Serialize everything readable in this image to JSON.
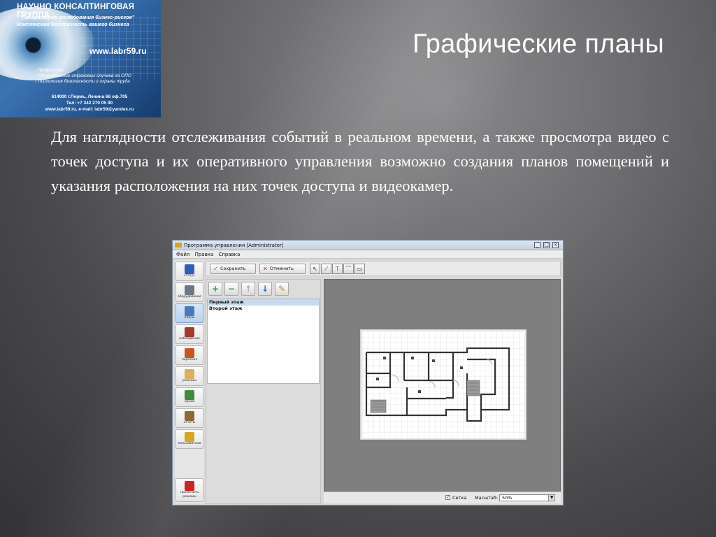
{
  "banner": {
    "title": "НАУЧНО КОНСАЛТИНГОВАЯ ГРУППА",
    "sub1": "\"Лаборатория исследования бизнес-рисков\"",
    "sub2": "Комплексная безопасность вашего бизнеса",
    "url": "www.labr59.ru",
    "bullets": [
      "- Профайлинг",
      "- Расследование страховых случаев на ОПО",
      "- Психология безопасности и охраны труда"
    ],
    "address": [
      "614000 г.Пермь, Ленина 66 оф.705",
      "Тел: +7 342 270 05 90",
      "www.labr59.ru, e-mail: labr59@yandex.ru"
    ]
  },
  "slide": {
    "title": "Графические планы",
    "body": "Для наглядности отслеживания событий в реальном времени, а также просмотра видео с точек доступа и их оперативного управления возможно  создания планов помещений и указания расположения на них точек доступа и видеокамер."
  },
  "app": {
    "window_title": "Программа управления [Administrator]",
    "menu": [
      "Файл",
      "Правка",
      "Справка"
    ],
    "nav": [
      {
        "label": "статус",
        "icon": "status-icon",
        "color": "#2e5fb8"
      },
      {
        "label": "оборудование",
        "icon": "equipment-icon",
        "color": "#6f7785"
      },
      {
        "label": "планы",
        "icon": "plans-icon",
        "color": "#4a79b8"
      },
      {
        "label": "наблюдение",
        "icon": "surveillance-icon",
        "color": "#a33a2a"
      },
      {
        "label": "персонал",
        "icon": "personnel-icon",
        "color": "#c2571f"
      },
      {
        "label": "режимы",
        "icon": "modes-icon",
        "color": "#d8b15a"
      },
      {
        "label": "архив",
        "icon": "archive-icon",
        "color": "#3f8a3f"
      },
      {
        "label": "отчеты",
        "icon": "reports-icon",
        "color": "#8a6a3a"
      },
      {
        "label": "пользователи",
        "icon": "users-icon",
        "color": "#d6a81c"
      },
      {
        "label": "применить режимы",
        "icon": "apply-modes-icon",
        "color": "#cc2222"
      }
    ],
    "toolbar": {
      "save_label": "Сохранить",
      "cancel_label": "Отменить"
    },
    "floors": [
      "Первый этаж",
      "Второй этаж"
    ],
    "status": {
      "grid_label": "Сетка",
      "grid_checked": true,
      "scale_label": "Масштаб:",
      "scale_value": "50%"
    }
  }
}
